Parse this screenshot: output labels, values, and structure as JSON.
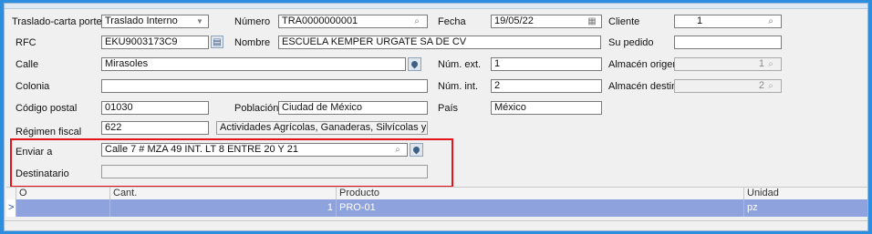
{
  "form": {
    "tipo_label": "Traslado-carta porte",
    "tipo_value": "Traslado Interno",
    "numero_label": "Número",
    "numero_value": "TRA0000000001",
    "fecha_label": "Fecha",
    "fecha_value": "19/05/22",
    "cliente_label": "Cliente",
    "cliente_value": "1",
    "rfc_label": "RFC",
    "rfc_value": "EKU9003173C9",
    "nombre_label": "Nombre",
    "nombre_value": "ESCUELA KEMPER URGATE SA DE CV",
    "su_pedido_label": "Su pedido",
    "su_pedido_value": "",
    "calle_label": "Calle",
    "calle_value": "Mirasoles",
    "num_ext_label": "Núm. ext.",
    "num_ext_value": "1",
    "almacen_origen_label": "Almacén origen",
    "almacen_origen_value": "1",
    "colonia_label": "Colonia",
    "colonia_value": "",
    "num_int_label": "Núm. int.",
    "num_int_value": "2",
    "almacen_destino_label": "Almacén destino",
    "almacen_destino_value": "2",
    "cp_label": "Código postal",
    "cp_value": "01030",
    "poblacion_label": "Población",
    "poblacion_value": "Ciudad de México",
    "pais_label": "País",
    "pais_value": "México",
    "regimen_label": "Régimen fiscal",
    "regimen_value": "622",
    "regimen_desc": "Actividades Agrícolas, Ganaderas, Silvícolas y Pesqu",
    "enviar_label": "Enviar a",
    "enviar_value": "Calle 7 # MZA 49 INT. LT 8 ENTRE 20 Y 21",
    "destinatario_label": "Destinatario",
    "destinatario_value": ""
  },
  "grid": {
    "columns": [
      "O",
      "Cant.",
      "Producto",
      "Unidad"
    ],
    "rows": [
      {
        "marker": ">",
        "o": "",
        "cant": "1",
        "producto": "PRO-01",
        "unidad": "pz"
      }
    ]
  },
  "icons": {
    "dropdown": "chevron-down-icon",
    "search": "search-icon",
    "calendar": "calendar-icon",
    "map_pin": "map-pin-icon",
    "card": "id-card-icon"
  },
  "colors": {
    "window_bg": "#2d8ee0",
    "selected_row": "#8ea2dd",
    "highlight_box": "#e3151a"
  }
}
